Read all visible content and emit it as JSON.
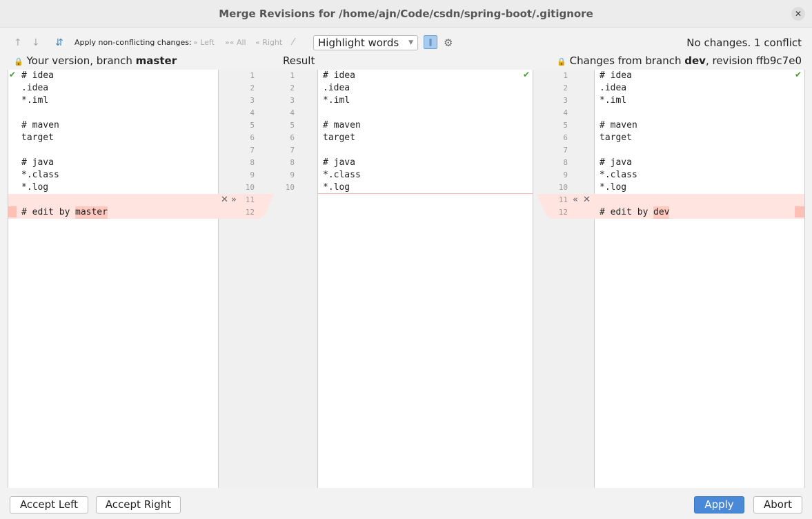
{
  "title": "Merge Revisions for /home/ajn/Code/csdn/spring-boot/.gitignore",
  "toolbar": {
    "apply_label": "Apply non-conflicting changes:",
    "left": "Left",
    "all": "All",
    "right": "Right",
    "highlight": "Highlight words",
    "status": "No changes. 1 conflict"
  },
  "headers": {
    "left_prefix": "Your version, branch ",
    "left_branch": "master",
    "result": "Result",
    "right_prefix": "Changes from branch ",
    "right_branch": "dev",
    "right_suffix": ", revision ffb9c7e0"
  },
  "left_lines": [
    "# idea",
    ".idea",
    "*.iml",
    "",
    "# maven",
    "target",
    "",
    "# java",
    "*.class",
    "*.log",
    "",
    "# edit by "
  ],
  "left_hl": "master",
  "result_lines": [
    "# idea",
    ".idea",
    "*.iml",
    "",
    "# maven",
    "target",
    "",
    "# java",
    "*.class",
    "*.log"
  ],
  "right_lines": [
    "# idea",
    ".idea",
    "*.iml",
    "",
    "# maven",
    "target",
    "",
    "# java",
    "*.class",
    "*.log",
    "",
    "# edit by "
  ],
  "right_hl": "dev",
  "left_nums": [
    "1",
    "2",
    "3",
    "4",
    "5",
    "6",
    "7",
    "8",
    "9",
    "10",
    "11",
    "12"
  ],
  "result_nums": [
    "1",
    "2",
    "3",
    "4",
    "5",
    "6",
    "7",
    "8",
    "9",
    "10"
  ],
  "buttons": {
    "accept_left": "Accept Left",
    "accept_right": "Accept Right",
    "apply": "Apply",
    "abort": "Abort"
  },
  "colors": {
    "conflict": "#ffe4e0",
    "accent": "#4a88d8"
  }
}
